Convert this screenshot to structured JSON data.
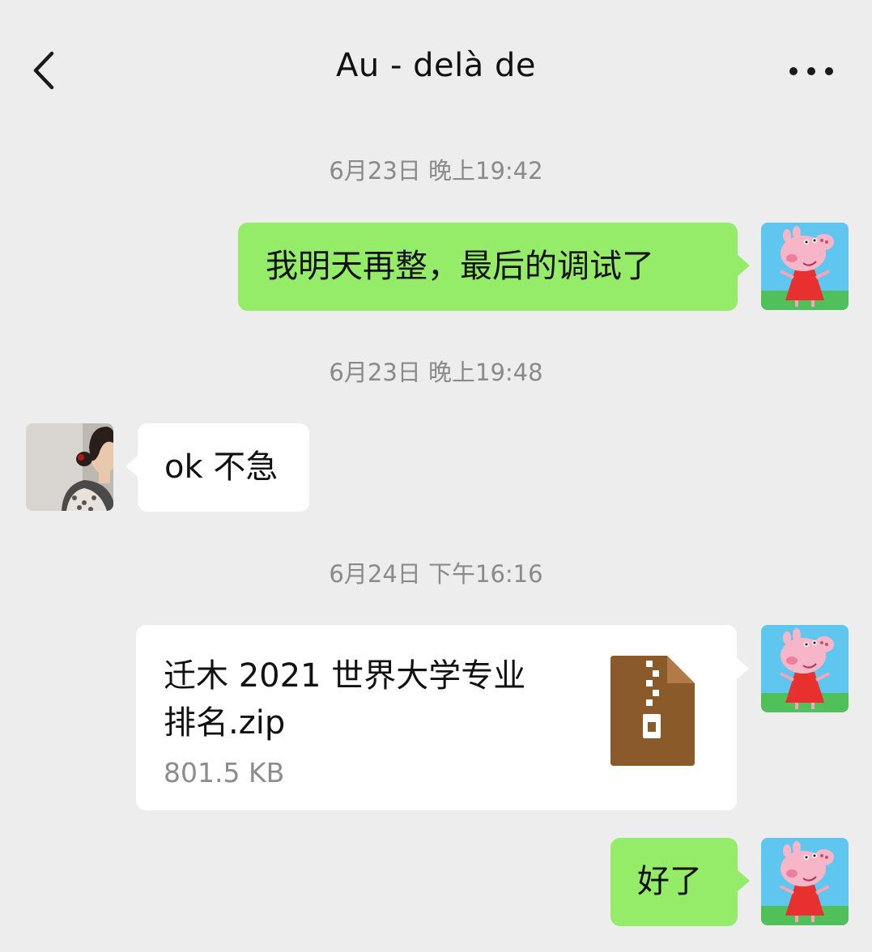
{
  "header": {
    "title": "Au - delà de",
    "back_icon": "chevron-left-icon",
    "more_icon": "more-dots-icon"
  },
  "messages": [
    {
      "type": "timestamp",
      "text": "6月23日 晚上19:42"
    },
    {
      "type": "text",
      "side": "right",
      "text": "我明天再整，最后的调试了",
      "avatar": "peppa-pig-avatar"
    },
    {
      "type": "timestamp",
      "text": "6月23日 晚上19:48"
    },
    {
      "type": "text",
      "side": "left",
      "text": "ok 不急",
      "avatar": "contact-avatar"
    },
    {
      "type": "timestamp",
      "text": "6月24日 下午16:16"
    },
    {
      "type": "file",
      "side": "right",
      "file_name_line1": "迁木 2021 世界大学专业",
      "file_name_line2": "排名.zip",
      "file_size": "801.5 KB",
      "file_icon": "zip-file-icon",
      "avatar": "peppa-pig-avatar"
    },
    {
      "type": "text",
      "side": "right",
      "text": "好了",
      "avatar": "peppa-pig-avatar"
    }
  ],
  "colors": {
    "background": "#ededed",
    "sent_bubble": "#95ec69",
    "received_bubble": "#ffffff",
    "timestamp_text": "#8a8a8a",
    "zip_icon": "#8b5a2b"
  }
}
